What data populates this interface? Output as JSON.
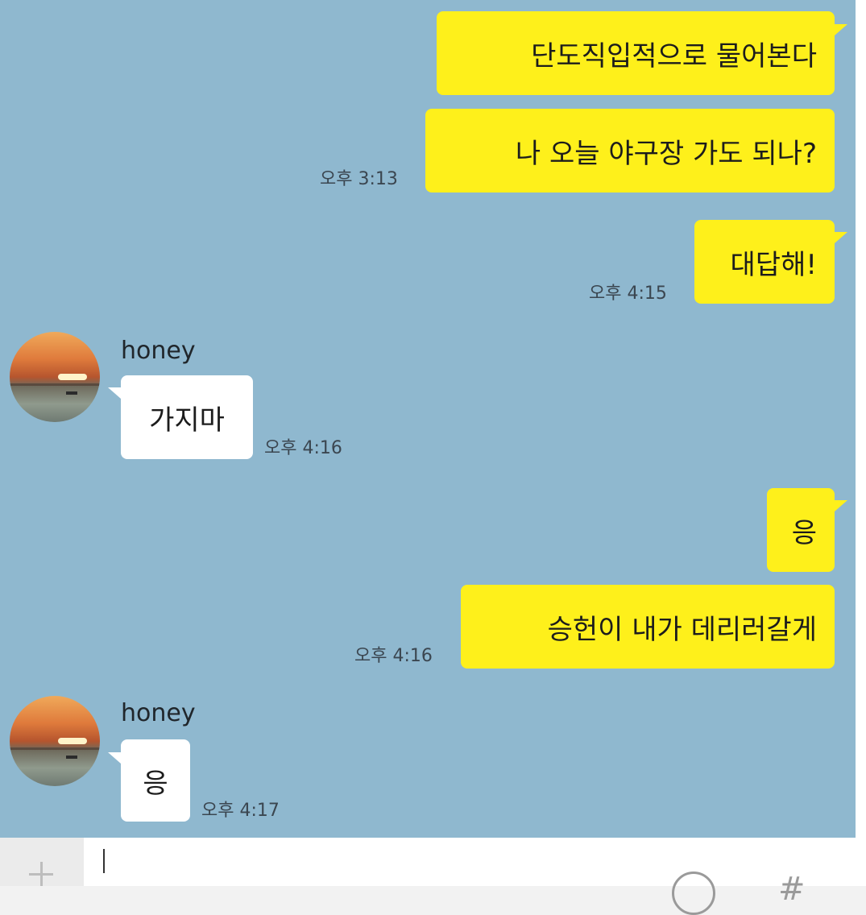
{
  "conversation": {
    "contact_name": "honey",
    "messages": [
      {
        "sender": "me",
        "text": "단도직입적으로 물어본다",
        "time": ""
      },
      {
        "sender": "me",
        "text": "나 오늘 야구장 가도 되나?",
        "time": "오후 3:13"
      },
      {
        "sender": "me",
        "text": "대답해!",
        "time": "오후 4:15"
      },
      {
        "sender": "honey",
        "text": "가지마",
        "time": "오후 4:16"
      },
      {
        "sender": "me",
        "text": "응",
        "time": ""
      },
      {
        "sender": "me",
        "text": "승헌이 내가 데리러갈게",
        "time": "오후 4:16"
      },
      {
        "sender": "honey",
        "text": "응",
        "time": "오후 4:17"
      }
    ]
  },
  "input_bar": {
    "icons": [
      "plus-icon",
      "emoji-icon",
      "hash-icon"
    ]
  },
  "colors": {
    "chat_background": "#8fb8cf",
    "my_bubble": "#fef01b",
    "their_bubble": "#ffffff"
  }
}
